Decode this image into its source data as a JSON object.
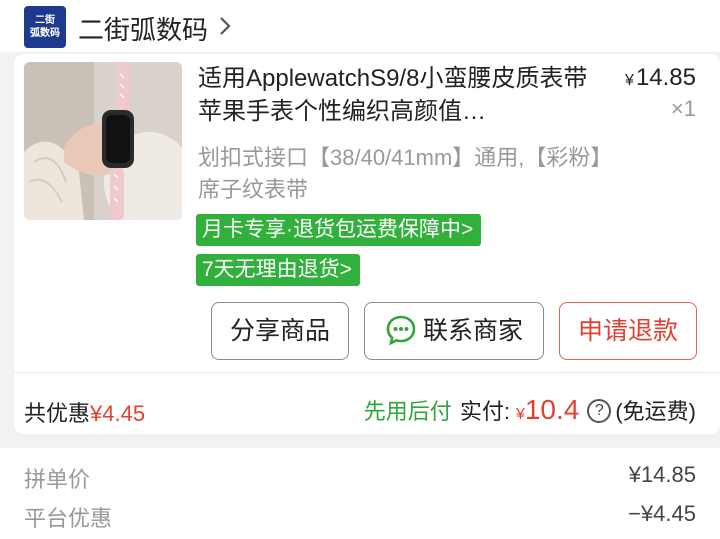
{
  "shop": {
    "logo_line1": "二街",
    "logo_line2": "弧数码",
    "name": "二街弧数码"
  },
  "product": {
    "title": "适用ApplewatchS9/8小蛮腰皮质表带苹果手表个性编织高颜值…",
    "price_currency": "¥",
    "price_value": "14.85",
    "quantity": "×1",
    "spec": "划扣式接口【38/40/41mm】通用,【彩粉】席子纹表带",
    "tags": [
      "月卡专享·退货包运费保障中>",
      "7天无理由退货>"
    ]
  },
  "actions": {
    "share_label": "分享商品",
    "contact_label": "联系商家",
    "refund_label": "申请退款"
  },
  "totals": {
    "discount_label": "共优惠",
    "discount_amount": "¥4.45",
    "pay_later_label": "先用后付",
    "paid_label": "实付:",
    "paid_currency": "¥",
    "paid_amount": "10.4",
    "help_symbol": "?",
    "shipping_note": "(免运费)"
  },
  "summary": {
    "rows": [
      {
        "label": "拼单价",
        "value": "¥14.85"
      },
      {
        "label": "平台优惠",
        "value": "−¥4.45"
      }
    ]
  },
  "colors": {
    "accent_red": "#e24033",
    "tag_green": "#31b03c",
    "logo_blue": "#1d3a8f"
  }
}
